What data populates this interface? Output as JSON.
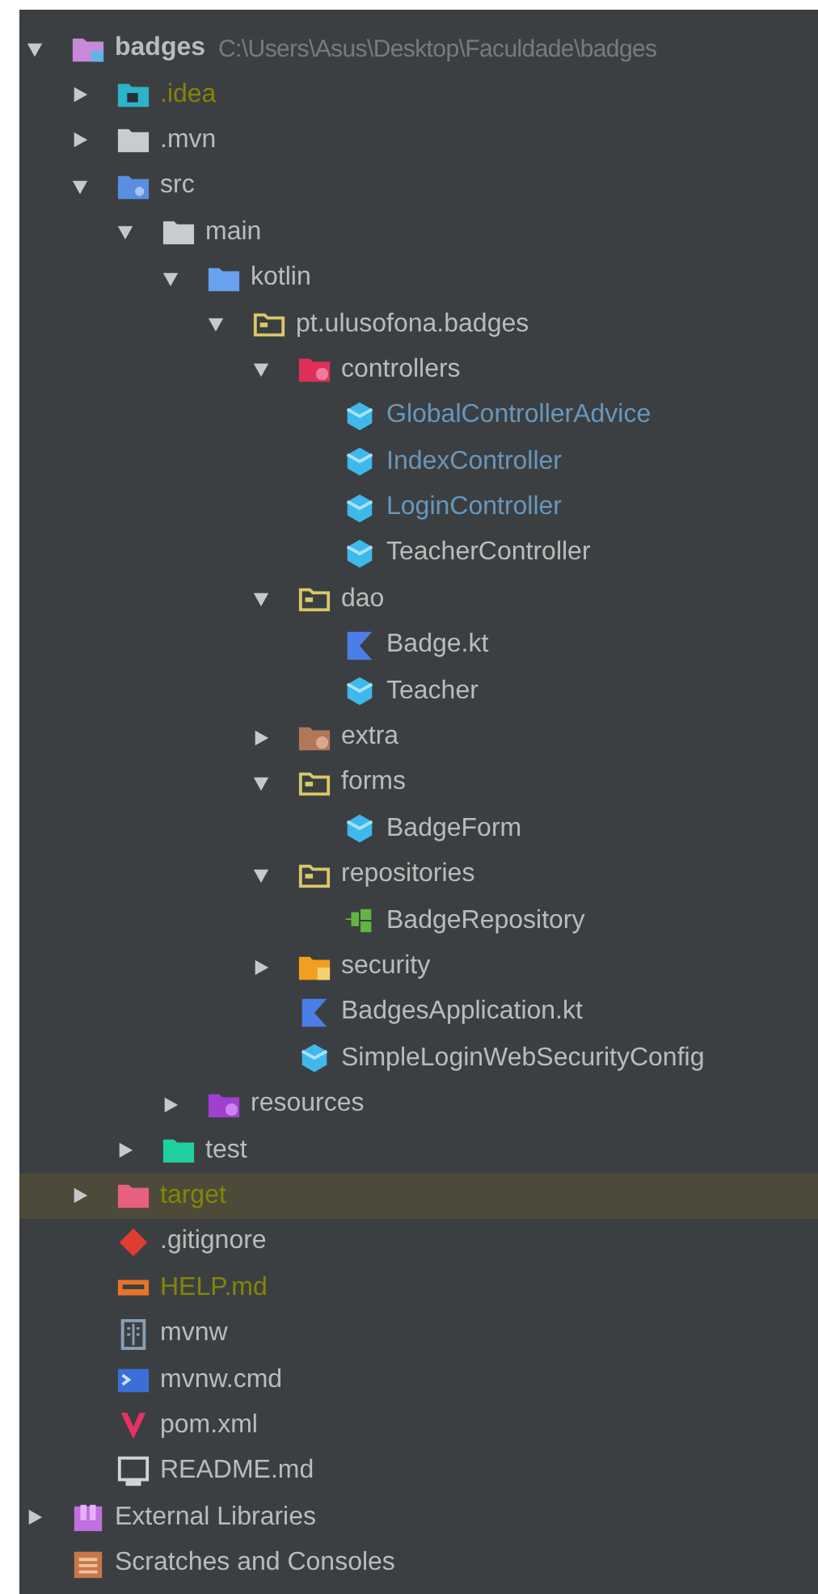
{
  "project_tree": {
    "nodes": [
      {
        "label": "badges",
        "path": "C:\\Users\\Asus\\Desktop\\Faculdade\\badges",
        "kind": "module",
        "color": "#bbbbbb",
        "expanded": true,
        "selected": false,
        "children": [
          {
            "label": ".idea",
            "kind": "idea",
            "color": "#848504",
            "expanded": false,
            "selected": false
          },
          {
            "label": ".mvn",
            "kind": "folder",
            "color": "#bbbbbb",
            "expanded": false,
            "selected": false
          },
          {
            "label": "src",
            "kind": "src",
            "color": "#bbbbbb",
            "expanded": true,
            "selected": false,
            "children": [
              {
                "label": "main",
                "kind": "folder",
                "color": "#bbbbbb",
                "expanded": true,
                "selected": false,
                "children": [
                  {
                    "label": "kotlin",
                    "kind": "root",
                    "color": "#bbbbbb",
                    "expanded": true,
                    "selected": false,
                    "children": [
                      {
                        "label": "pt.ulusofona.badges",
                        "kind": "package",
                        "color": "#bbbbbb",
                        "expanded": true,
                        "selected": false,
                        "children": [
                          {
                            "label": "controllers",
                            "kind": "controllers",
                            "color": "#bbbbbb",
                            "expanded": true,
                            "selected": false,
                            "children": [
                              {
                                "label": "GlobalControllerAdvice",
                                "kind": "class",
                                "color": "#6897bb",
                                "selected": false
                              },
                              {
                                "label": "IndexController",
                                "kind": "class",
                                "color": "#6897bb",
                                "selected": false
                              },
                              {
                                "label": "LoginController",
                                "kind": "class",
                                "color": "#6897bb",
                                "selected": false
                              },
                              {
                                "label": "TeacherController",
                                "kind": "class",
                                "color": "#bbbbbb",
                                "selected": false
                              }
                            ]
                          },
                          {
                            "label": "dao",
                            "kind": "package",
                            "color": "#bbbbbb",
                            "expanded": true,
                            "selected": false,
                            "children": [
                              {
                                "label": "Badge.kt",
                                "kind": "kotlin",
                                "color": "#bbbbbb",
                                "selected": false
                              },
                              {
                                "label": "Teacher",
                                "kind": "class",
                                "color": "#bbbbbb",
                                "selected": false
                              }
                            ]
                          },
                          {
                            "label": "extra",
                            "kind": "extra",
                            "color": "#bbbbbb",
                            "expanded": false,
                            "selected": false
                          },
                          {
                            "label": "forms",
                            "kind": "package",
                            "color": "#bbbbbb",
                            "expanded": true,
                            "selected": false,
                            "children": [
                              {
                                "label": "BadgeForm",
                                "kind": "class",
                                "color": "#bbbbbb",
                                "selected": false
                              }
                            ]
                          },
                          {
                            "label": "repositories",
                            "kind": "package",
                            "color": "#bbbbbb",
                            "expanded": true,
                            "selected": false,
                            "children": [
                              {
                                "label": "BadgeRepository",
                                "kind": "interface",
                                "color": "#bbbbbb",
                                "selected": false
                              }
                            ]
                          },
                          {
                            "label": "security",
                            "kind": "security",
                            "color": "#bbbbbb",
                            "expanded": false,
                            "selected": false
                          },
                          {
                            "label": "BadgesApplication.kt",
                            "kind": "kotlin",
                            "color": "#bbbbbb",
                            "selected": false
                          },
                          {
                            "label": "SimpleLoginWebSecurityConfig",
                            "kind": "class",
                            "color": "#bbbbbb",
                            "selected": false
                          }
                        ]
                      }
                    ]
                  },
                  {
                    "label": "resources",
                    "kind": "resources",
                    "color": "#bbbbbb",
                    "expanded": false,
                    "selected": false
                  }
                ]
              },
              {
                "label": "test",
                "kind": "test",
                "color": "#bbbbbb",
                "expanded": false,
                "selected": false
              }
            ]
          },
          {
            "label": "target",
            "kind": "target",
            "color": "#848504",
            "expanded": false,
            "selected": true
          },
          {
            "label": ".gitignore",
            "kind": "git",
            "color": "#bbbbbb",
            "selected": false
          },
          {
            "label": "HELP.md",
            "kind": "markdown",
            "color": "#848504",
            "selected": false
          },
          {
            "label": "mvnw",
            "kind": "text",
            "color": "#bbbbbb",
            "selected": false
          },
          {
            "label": "mvnw.cmd",
            "kind": "cmd",
            "color": "#bbbbbb",
            "selected": false
          },
          {
            "label": "pom.xml",
            "kind": "maven",
            "color": "#bbbbbb",
            "selected": false
          },
          {
            "label": "README.md",
            "kind": "readme",
            "color": "#bbbbbb",
            "selected": false
          }
        ]
      },
      {
        "label": "External Libraries",
        "kind": "libraries",
        "color": "#bbbbbb",
        "expanded": false,
        "selected": false
      },
      {
        "label": "Scratches and Consoles",
        "kind": "scratches",
        "color": "#bbbbbb",
        "selected": false
      }
    ]
  }
}
